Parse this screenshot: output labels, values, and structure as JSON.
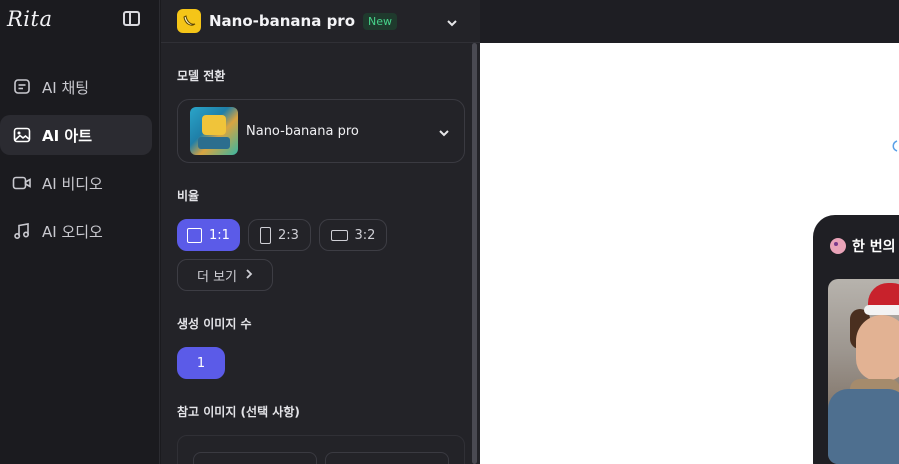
{
  "sidebar": {
    "logo": "Rita",
    "items": [
      {
        "label": "AI 채팅",
        "icon": "chat-icon"
      },
      {
        "label": "AI 아트",
        "icon": "image-icon",
        "active": true
      },
      {
        "label": "AI 비디오",
        "icon": "video-icon"
      },
      {
        "label": "AI 오디오",
        "icon": "music-icon"
      }
    ]
  },
  "panel": {
    "header_title": "Nano-banana pro",
    "header_badge": "New",
    "model_section_label": "모델 전환",
    "model_name": "Nano-banana pro",
    "ratio_section_label": "비율",
    "ratios": [
      {
        "label": "1:1",
        "active": true
      },
      {
        "label": "2:3",
        "active": false
      },
      {
        "label": "3:2",
        "active": false
      }
    ],
    "more_label": "더 보기",
    "count_section_label": "생성 이미지 수",
    "count_value": "1",
    "reference_section_label": "참고 이미지 (선택 사항)"
  },
  "main": {
    "preview_title": "한 번의"
  },
  "colors": {
    "accent": "#5b5be8",
    "badge_text": "#47d28a",
    "banana_bg": "#f5c518"
  }
}
